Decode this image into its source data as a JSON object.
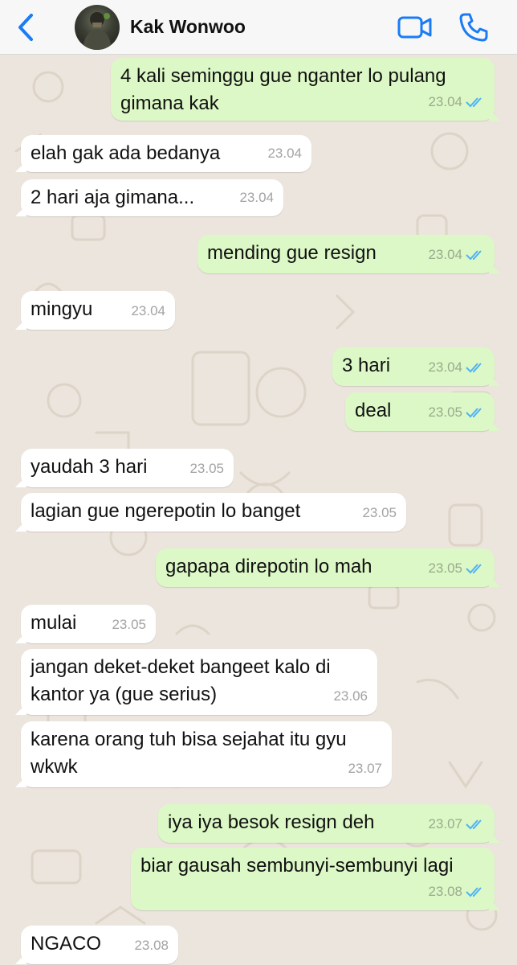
{
  "header": {
    "contact_name": "Kak Wonwoo",
    "back_icon": "chevron-left-icon",
    "video_icon": "video-camera-icon",
    "call_icon": "phone-icon",
    "accent_color": "#1a7cf5"
  },
  "messages": [
    {
      "direction": "out",
      "text": "4 kali seminggu gue nganter lo pulang\ngimana kak",
      "time": "23.04",
      "read": true
    },
    {
      "direction": "in",
      "text": "elah gak ada bedanya",
      "time": "23.04"
    },
    {
      "direction": "in",
      "text": "2 hari aja gimana...",
      "time": "23.04"
    },
    {
      "direction": "out",
      "text": "mending gue resign",
      "time": "23.04",
      "read": true
    },
    {
      "direction": "in",
      "text": "mingyu",
      "time": "23.04"
    },
    {
      "direction": "out",
      "text": "3 hari",
      "time": "23.04",
      "read": true
    },
    {
      "direction": "out",
      "text": "deal",
      "time": "23.05",
      "read": true
    },
    {
      "direction": "in",
      "text": "yaudah 3 hari",
      "time": "23.05"
    },
    {
      "direction": "in",
      "text": "lagian gue ngerepotin lo banget",
      "time": "23.05"
    },
    {
      "direction": "out",
      "text": "gapapa direpotin lo mah",
      "time": "23.05",
      "read": true
    },
    {
      "direction": "in",
      "text": "mulai",
      "time": "23.05"
    },
    {
      "direction": "in",
      "text": "jangan deket-deket bangeet kalo di\nkantor ya (gue serius)",
      "time": "23.06"
    },
    {
      "direction": "in",
      "text": "karena orang tuh bisa sejahat itu gyu\nwkwk",
      "time": "23.07"
    },
    {
      "direction": "out",
      "text": "iya iya besok resign deh",
      "time": "23.07",
      "read": true
    },
    {
      "direction": "out",
      "text": "biar gausah sembunyi-sembunyi lagi",
      "time": "23.08",
      "read": true
    },
    {
      "direction": "in",
      "text": "NGACO",
      "time": "23.08"
    }
  ],
  "colors": {
    "incoming_bubble": "#ffffff",
    "outgoing_bubble": "#dcf8c6",
    "read_ticks": "#4fb3f6",
    "wallpaper": "#ece5dd"
  }
}
